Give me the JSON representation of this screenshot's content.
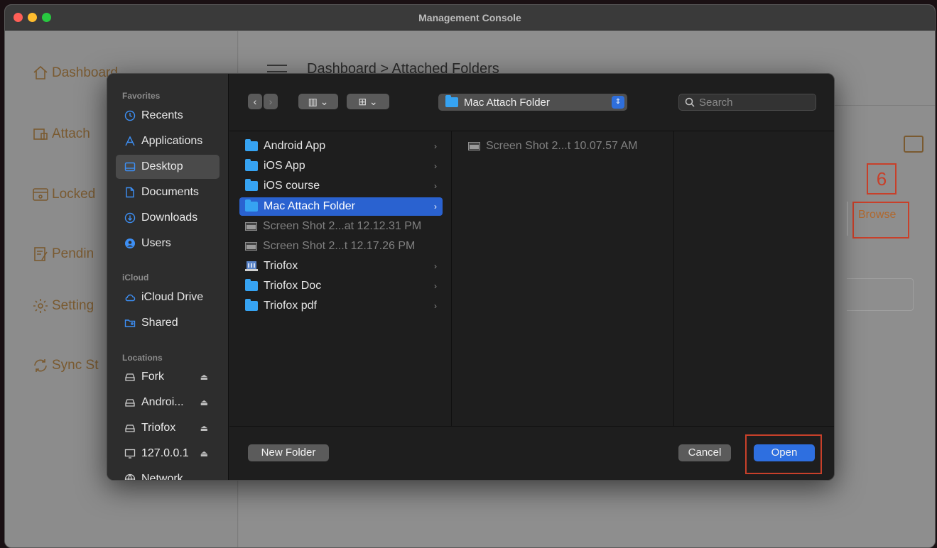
{
  "window": {
    "title": "Management Console"
  },
  "app_sidebar": {
    "items": [
      {
        "label": "Dashboard",
        "icon": "home-icon"
      },
      {
        "label": "Attach",
        "icon": "attach-icon"
      },
      {
        "label": "Locked",
        "icon": "lock-icon"
      },
      {
        "label": "Pendin",
        "icon": "pending-icon"
      },
      {
        "label": "Setting",
        "icon": "gear-icon"
      },
      {
        "label": "Sync St",
        "icon": "sync-icon"
      }
    ]
  },
  "app_main": {
    "breadcrumb": "Dashboard > Attached Folders",
    "step_number": "6",
    "browse_label": "Browse"
  },
  "dialog": {
    "sidebar": {
      "favorites_header": "Favorites",
      "favorites": [
        {
          "label": "Recents",
          "icon": "clock-icon"
        },
        {
          "label": "Applications",
          "icon": "applications-icon"
        },
        {
          "label": "Desktop",
          "icon": "desktop-icon",
          "selected": true
        },
        {
          "label": "Documents",
          "icon": "document-icon"
        },
        {
          "label": "Downloads",
          "icon": "download-icon"
        },
        {
          "label": "Users",
          "icon": "user-icon"
        }
      ],
      "icloud_header": "iCloud",
      "icloud": [
        {
          "label": "iCloud Drive",
          "icon": "cloud-icon"
        },
        {
          "label": "Shared",
          "icon": "shared-folder-icon"
        }
      ],
      "locations_header": "Locations",
      "locations": [
        {
          "label": "Fork",
          "icon": "drive-icon"
        },
        {
          "label": "Androi...",
          "icon": "drive-icon"
        },
        {
          "label": "Triofox",
          "icon": "drive-icon"
        },
        {
          "label": "127.0.0.1",
          "icon": "monitor-icon"
        },
        {
          "label": "Network",
          "icon": "globe-icon"
        }
      ]
    },
    "toolbar": {
      "back_label": "‹",
      "forward_label": "›",
      "column_view_label": "▥ ⌄",
      "group_label": "⊞ ⌄",
      "path_label": "Mac Attach Folder",
      "search_placeholder": "Search"
    },
    "column1": [
      {
        "label": "Android App",
        "type": "folder"
      },
      {
        "label": "iOS App",
        "type": "folder"
      },
      {
        "label": "iOS course",
        "type": "folder"
      },
      {
        "label": "Mac Attach Folder",
        "type": "folder",
        "selected": true
      },
      {
        "label": "Screen Shot 2...at 12.12.31 PM",
        "type": "image"
      },
      {
        "label": "Screen Shot 2...t 12.17.26 PM",
        "type": "image"
      },
      {
        "label": "Triofox",
        "type": "app"
      },
      {
        "label": "Triofox Doc",
        "type": "folder"
      },
      {
        "label": "Triofox pdf",
        "type": "folder"
      }
    ],
    "column2": [
      {
        "label": "Screen Shot 2...t 10.07.57 AM",
        "type": "image"
      }
    ],
    "footer": {
      "new_folder": "New Folder",
      "cancel": "Cancel",
      "open": "Open"
    }
  },
  "colors": {
    "accent_blue": "#2e6fe0",
    "annotation_red": "#c8402a",
    "folder_blue": "#36a3f2"
  }
}
